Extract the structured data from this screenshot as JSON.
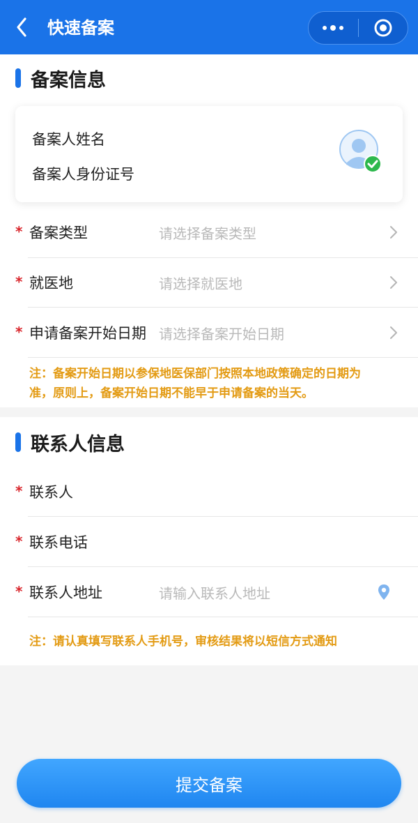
{
  "header": {
    "title": "快速备案"
  },
  "section1": {
    "title": "备案信息",
    "card": {
      "name_label": "备案人姓名",
      "id_label": "备案人身份证号"
    },
    "fields": [
      {
        "label": "备案类型",
        "placeholder": "请选择备案类型"
      },
      {
        "label": "就医地",
        "placeholder": "请选择就医地"
      },
      {
        "label": "申请备案开始日期",
        "placeholder": "请选择备案开始日期"
      }
    ],
    "note_line1": "注：备案开始日期以参保地医保部门按照本地政策确定的日期为",
    "note_line2": "准，原则上，备案开始日期不能早于申请备案的当天。"
  },
  "section2": {
    "title": "联系人信息",
    "fields": [
      {
        "label": "联系人",
        "placeholder": ""
      },
      {
        "label": "联系电话",
        "placeholder": ""
      },
      {
        "label": "联系人地址",
        "placeholder": "请输入联系人地址"
      }
    ],
    "note": "注：请认真填写联系人手机号，审核结果将以短信方式通知"
  },
  "required_mark": "*",
  "submit_label": "提交备案",
  "colors": {
    "primary": "#1a73e8",
    "note": "#e39b14",
    "required": "#d9262c",
    "success": "#2db84d"
  }
}
